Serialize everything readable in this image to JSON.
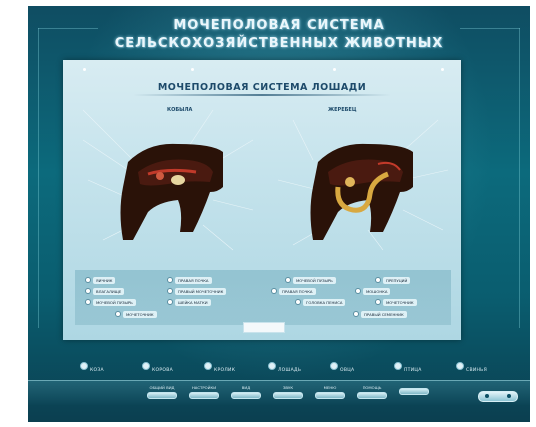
{
  "header": {
    "title_line1": "МОЧЕПОЛОВАЯ СИСТЕМА",
    "title_line2": "СЕЛЬСКОХОЗЯЙСТВЕННЫХ ЖИВОТНЫХ"
  },
  "panel": {
    "title": "МОЧЕПОЛОВАЯ СИСТЕМА ЛОШАДИ",
    "left_label": "КОБЫЛА",
    "right_label": "ЖЕРЕБЕЦ",
    "left_legend": [
      {
        "label": "ЯИЧНИК",
        "icon": "circle-icon"
      },
      {
        "label": "ПРАВАЯ ПОЧКА",
        "icon": "circle-icon"
      },
      {
        "label": "ВЛАГАЛИЩЕ",
        "icon": "circle-icon"
      },
      {
        "label": "ПРАВЫЙ МОЧЕТОЧНИК",
        "icon": "circle-icon"
      },
      {
        "label": "МОЧЕВОЙ ПУЗЫРЬ",
        "icon": "circle-icon"
      },
      {
        "label": "ШЕЙКА МАТКИ",
        "icon": "circle-icon"
      },
      {
        "label": "МОЧЕТОЧНИК",
        "icon": "circle-icon"
      }
    ],
    "right_legend": [
      {
        "label": "МОЧЕВОЙ ПУЗЫРЬ",
        "icon": "circle-icon"
      },
      {
        "label": "ПРЕПУЦИЙ",
        "icon": "circle-icon"
      },
      {
        "label": "ПРАВАЯ ПОЧКА",
        "icon": "circle-icon"
      },
      {
        "label": "МОШОНКА",
        "icon": "circle-icon"
      },
      {
        "label": "ГОЛОВКА ПЕНИСА",
        "icon": "circle-icon"
      },
      {
        "label": "МОЧЕТОЧНИК",
        "icon": "circle-icon"
      },
      {
        "label": "ПРАВЫЙ СЕМЕННИК",
        "icon": "circle-icon"
      }
    ]
  },
  "nav": [
    {
      "label": "КОЗА"
    },
    {
      "label": "КОРОВА"
    },
    {
      "label": "КРОЛИК"
    },
    {
      "label": "ЛОШАДЬ"
    },
    {
      "label": "ОВЦА"
    },
    {
      "label": "ПТИЦА"
    },
    {
      "label": "СВИНЬЯ"
    }
  ],
  "controls": [
    {
      "label": "ОБЩИЙ ВИД"
    },
    {
      "label": "НАСТРОЙКИ"
    },
    {
      "label": "ВИД"
    },
    {
      "label": "ЗВУК"
    },
    {
      "label": "МЕНЮ"
    },
    {
      "label": "ПОМОЩЬ"
    },
    {
      "label": ""
    }
  ],
  "colors": {
    "background": "#0c6a7c",
    "panel": "#c5e3ec",
    "title_text": "#1d4a6a",
    "organ_highlight": "#d8a840"
  }
}
